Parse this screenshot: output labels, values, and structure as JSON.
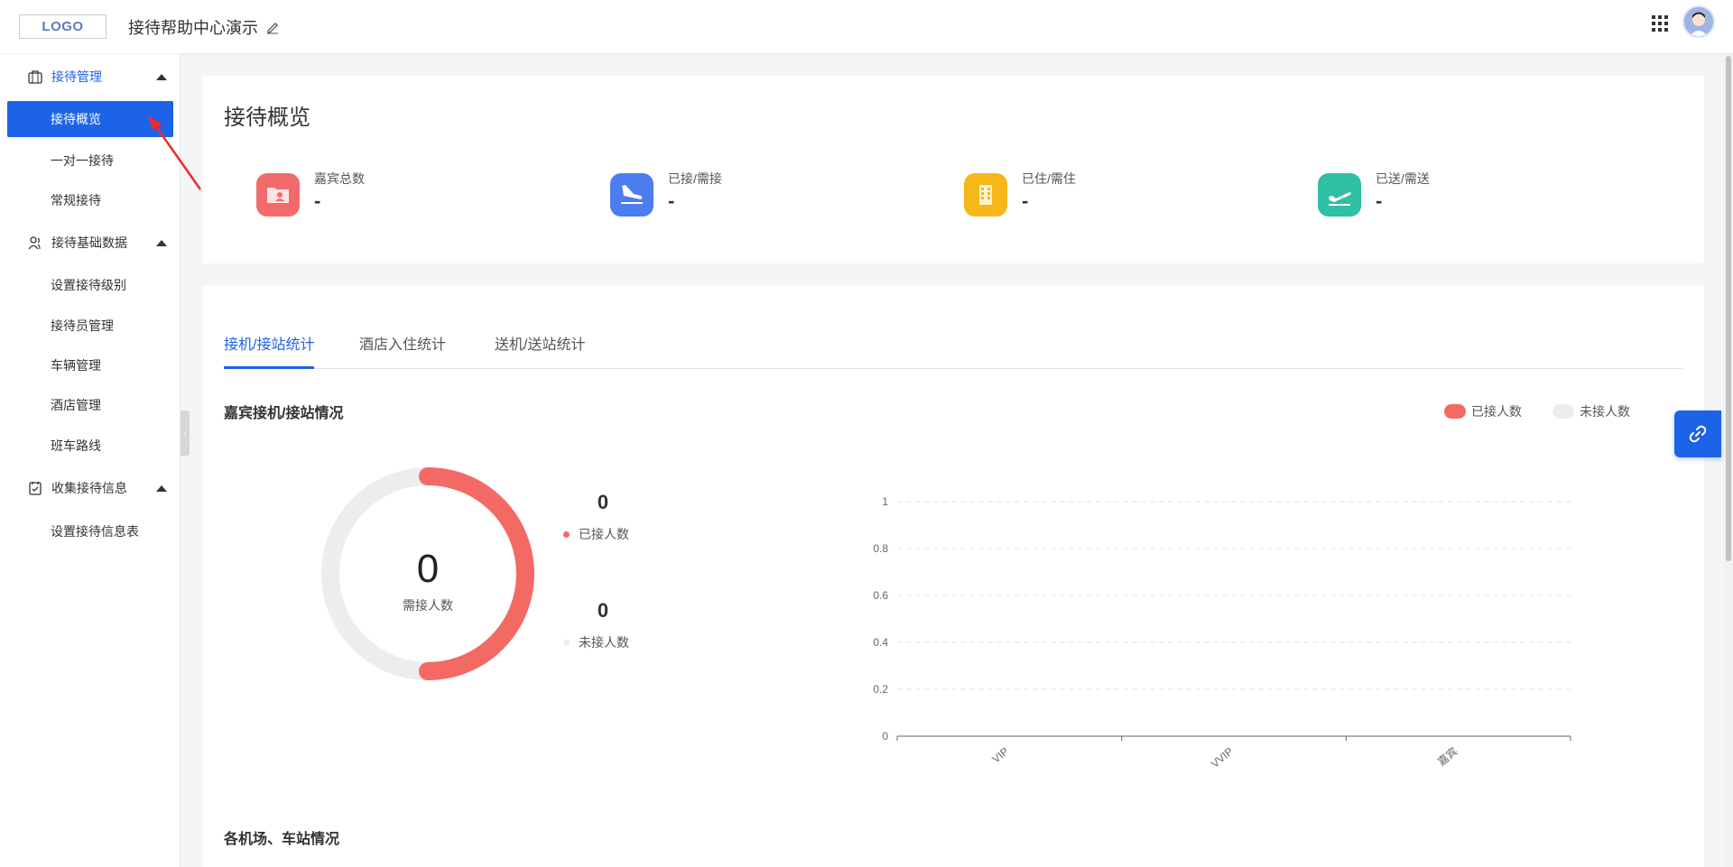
{
  "header": {
    "logo_text": "LOGO",
    "app_title": "接待帮助中心演示"
  },
  "sidebar": {
    "groups": [
      {
        "label": "接待管理",
        "icon": "briefcase-icon",
        "items": [
          "接待概览",
          "一对一接待",
          "常规接待"
        ]
      },
      {
        "label": "接待基础数据",
        "icon": "users-icon",
        "items": [
          "设置接待级别",
          "接待员管理",
          "车辆管理",
          "酒店管理",
          "班车路线"
        ]
      },
      {
        "label": "收集接待信息",
        "icon": "clipboard-icon",
        "items": [
          "设置接待信息表"
        ]
      }
    ],
    "active_item": "接待概览"
  },
  "overview": {
    "title": "接待概览",
    "stats": [
      {
        "label": "嘉宾总数",
        "value": "-",
        "icon": "guest-folder-icon",
        "color": "#f26b6b"
      },
      {
        "label": "已接/需接",
        "value": "-",
        "icon": "plane-arrival-icon",
        "color": "#4c7df0"
      },
      {
        "label": "已住/需住",
        "value": "-",
        "icon": "hotel-icon",
        "color": "#f5b71a"
      },
      {
        "label": "已送/需送",
        "value": "-",
        "icon": "plane-departure-icon",
        "color": "#2fbfa3"
      }
    ]
  },
  "tabs": [
    "接机/接站统计",
    "酒店入住统计",
    "送机/送站统计"
  ],
  "active_tab": "接机/接站统计",
  "pickup_section": {
    "title": "嘉宾接机/接站情况",
    "legend": [
      {
        "label": "已接人数",
        "color": "#f36a64"
      },
      {
        "label": "未接人数",
        "color": "#ededed"
      }
    ],
    "donut": {
      "center_value": "0",
      "center_label": "需接人数",
      "picked_value": "0",
      "picked_label": "已接人数",
      "unpicked_value": "0",
      "unpicked_label": "未接人数"
    }
  },
  "airport_section": {
    "title": "各机场、车站情况"
  },
  "chart_data": {
    "type": "bar",
    "categories": [
      "VIP",
      "VVIP",
      "嘉宾"
    ],
    "series": [
      {
        "name": "已接人数",
        "values": [
          0,
          0,
          0
        ]
      },
      {
        "name": "未接人数",
        "values": [
          0,
          0,
          0
        ]
      }
    ],
    "yticks": [
      "0",
      "0.2",
      "0.4",
      "0.6",
      "0.8",
      "1"
    ],
    "ylim": [
      0,
      1
    ],
    "grid": true,
    "legend_position": "top-right"
  }
}
